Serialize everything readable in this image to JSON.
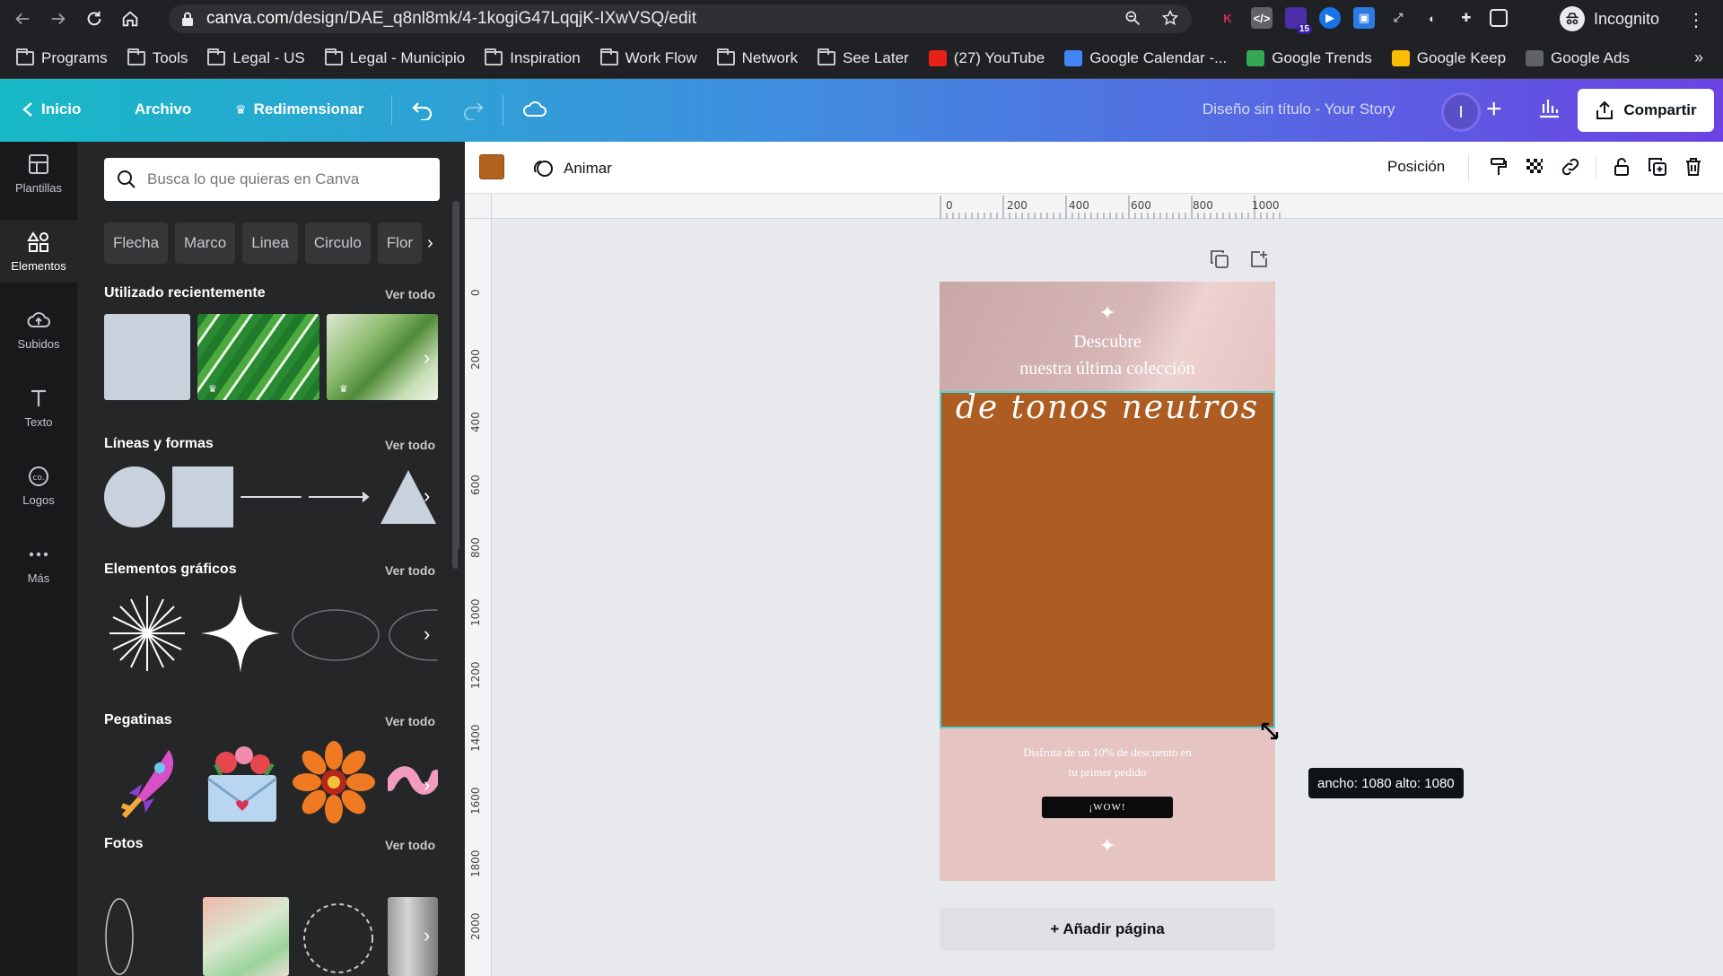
{
  "browser": {
    "url_host": "canva.com",
    "url_path": "/design/DAE_q8nl8mk/4-1kogiG47LqqjK-IXwVSQ/edit",
    "profile_label": "Incognito",
    "extension_badge": "15",
    "bookmarks": [
      {
        "label": "Programs",
        "kind": "folder"
      },
      {
        "label": "Tools",
        "kind": "folder"
      },
      {
        "label": "Legal - US",
        "kind": "folder"
      },
      {
        "label": "Legal - Municipio",
        "kind": "folder"
      },
      {
        "label": "Inspiration",
        "kind": "folder"
      },
      {
        "label": "Work Flow",
        "kind": "folder"
      },
      {
        "label": "Network",
        "kind": "folder"
      },
      {
        "label": "See Later",
        "kind": "folder"
      },
      {
        "label": "(27) YouTube",
        "kind": "youtube"
      },
      {
        "label": "Google Calendar -...",
        "kind": "calendar"
      },
      {
        "label": "Google Trends",
        "kind": "trends"
      },
      {
        "label": "Google Keep",
        "kind": "keep"
      },
      {
        "label": "Google Ads",
        "kind": "ads"
      }
    ],
    "bookmarks_more": "»"
  },
  "header": {
    "back_label": "Inicio",
    "file_label": "Archivo",
    "resize_label": "Redimensionar",
    "design_title": "Diseño sin título - Your Story",
    "avatar_initial": "I",
    "share_label": "Compartir"
  },
  "rail": {
    "items": [
      {
        "label": "Plantillas",
        "icon": "templates-icon"
      },
      {
        "label": "Elementos",
        "icon": "elements-icon"
      },
      {
        "label": "Subidos",
        "icon": "upload-cloud-icon"
      },
      {
        "label": "Texto",
        "icon": "text-icon"
      },
      {
        "label": "Logos",
        "icon": "logo-icon"
      },
      {
        "label": "Más",
        "icon": "more-icon"
      }
    ],
    "active": "Elementos"
  },
  "panel": {
    "search_placeholder": "Busca lo que quieras en Canva",
    "chips": [
      "Flecha",
      "Marco",
      "Linea",
      "Circulo",
      "Flor"
    ],
    "see_all": "Ver todo",
    "sections": {
      "recent": "Utilizado recientemente",
      "lines": "Líneas y formas",
      "graphics": "Elementos gráficos",
      "stickers": "Pegatinas",
      "photos": "Fotos"
    }
  },
  "toolbar": {
    "color_hex": "#b2621f",
    "animate_label": "Animar",
    "position_label": "Posición"
  },
  "rulers": {
    "h_ticks": [
      "0",
      "200",
      "400",
      "600",
      "800",
      "1000"
    ],
    "v_ticks": [
      "0",
      "200",
      "400",
      "600",
      "800",
      "1000",
      "1200",
      "1400",
      "1600",
      "1800",
      "2000"
    ]
  },
  "design": {
    "line1": "Descubre",
    "line2": "nuestra última colección",
    "script": "de tonos neutros",
    "promo_line1": "Disfruta de un 10% de descuento en",
    "promo_line2": "tu primer pedido",
    "cta": "¡WOW!",
    "element_color": "#ad5c22",
    "background_color": "#e6c4c2"
  },
  "size_tooltip": "ancho: 1080 alto: 1080",
  "add_page_label": "+ Añadir página"
}
